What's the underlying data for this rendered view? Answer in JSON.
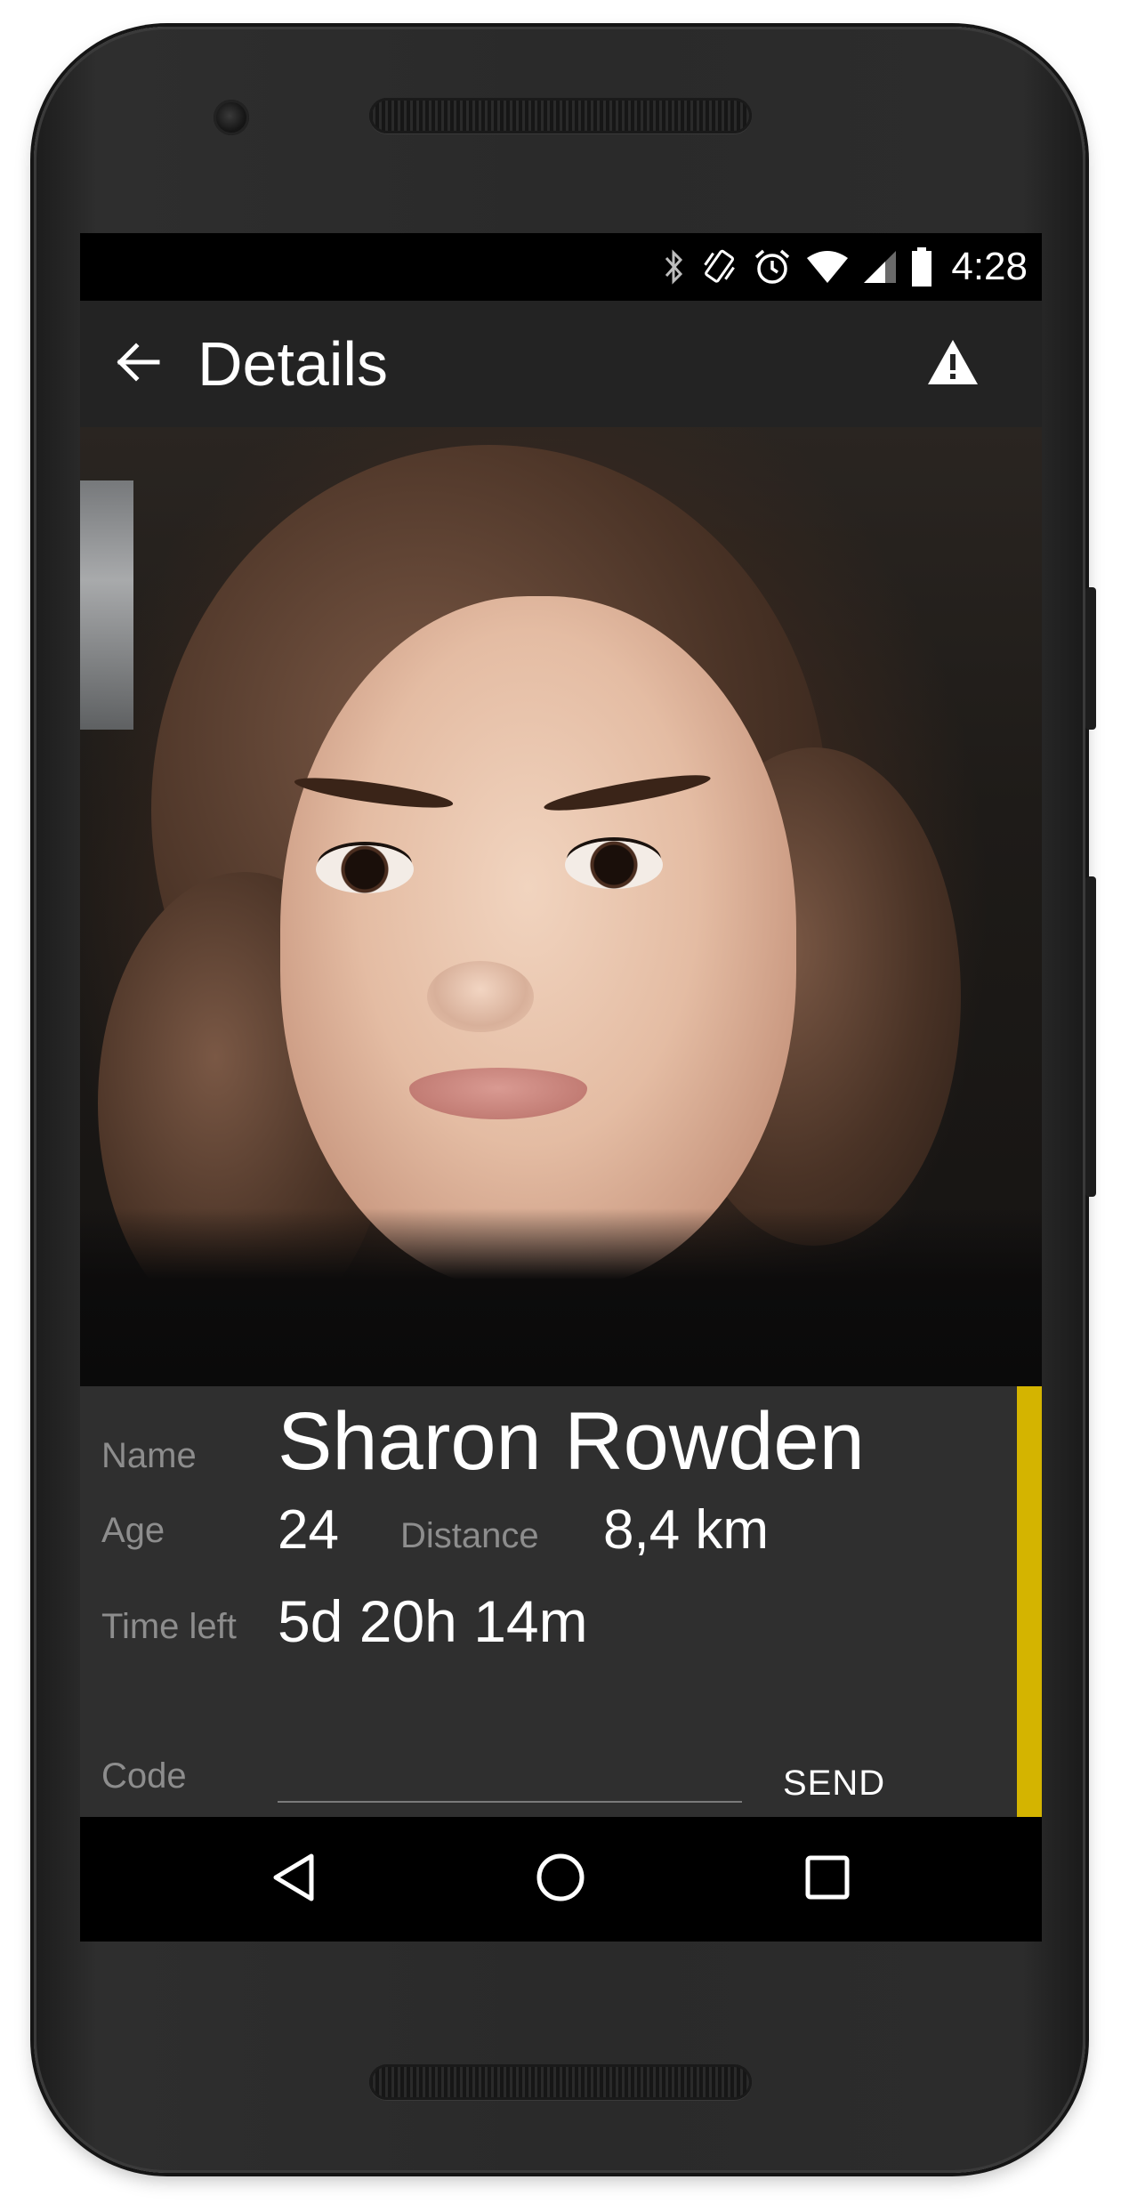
{
  "status_bar": {
    "time": "4:28",
    "icons": [
      "bluetooth-icon",
      "vibrate-icon",
      "alarm-icon",
      "wifi-icon",
      "signal-icon",
      "battery-icon"
    ]
  },
  "app_bar": {
    "title": "Details",
    "back_icon": "arrow-back-icon",
    "action_icon": "warning-icon"
  },
  "profile": {
    "photo_alt": "profile photo",
    "name_label": "Name",
    "name": "Sharon Rowden",
    "age_label": "Age",
    "age": "24",
    "distance_label": "Distance",
    "distance": "8,4 km",
    "time_left_label": "Time left",
    "time_left": "5d 20h 14m"
  },
  "code_form": {
    "label": "Code",
    "value": "",
    "send_label": "SEND"
  },
  "colors": {
    "app_bar": "#232323",
    "card": "#2f2f2f",
    "accent": "#d4b400",
    "label": "#8d8d8d",
    "text": "#ffffff"
  },
  "nav_bar": {
    "icons": [
      "nav-back-icon",
      "nav-home-icon",
      "nav-recents-icon"
    ]
  }
}
